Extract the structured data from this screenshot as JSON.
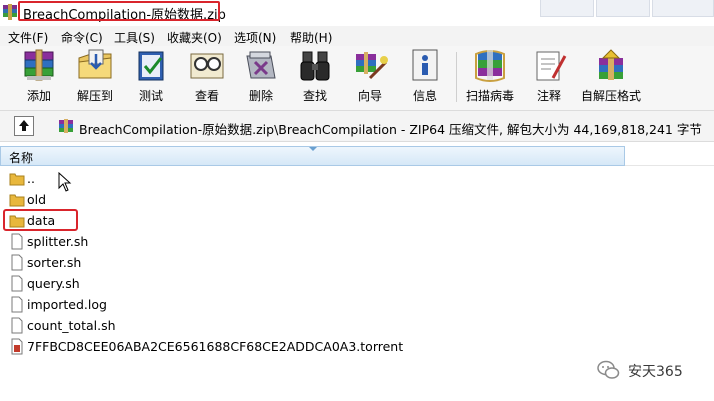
{
  "title": {
    "text": "BreachCompilation-原始数据.zip"
  },
  "menu": {
    "items": [
      {
        "label": "文件(F)"
      },
      {
        "label": "命令(C)"
      },
      {
        "label": "工具(S)"
      },
      {
        "label": "收藏夹(O)"
      },
      {
        "label": "选项(N)"
      },
      {
        "label": "帮助(H)"
      }
    ]
  },
  "toolbar": {
    "buttons": [
      {
        "label": "添加",
        "icon": "add-books-icon"
      },
      {
        "label": "解压到",
        "icon": "extract-to-icon"
      },
      {
        "label": "测试",
        "icon": "test-icon"
      },
      {
        "label": "查看",
        "icon": "view-icon"
      },
      {
        "label": "删除",
        "icon": "delete-icon"
      },
      {
        "label": "查找",
        "icon": "find-binoculars-icon"
      },
      {
        "label": "向导",
        "icon": "wizard-icon"
      },
      {
        "label": "信息",
        "icon": "info-icon"
      },
      {
        "label": "扫描病毒",
        "icon": "virus-scan-icon"
      },
      {
        "label": "注释",
        "icon": "comment-icon"
      },
      {
        "label": "自解压格式",
        "icon": "sfx-icon"
      }
    ]
  },
  "address": {
    "path": "BreachCompilation-原始数据.zip\\BreachCompilation - ZIP64 压缩文件, 解包大小为 44,169,818,241 字节"
  },
  "list": {
    "column_name": "名称",
    "rows": [
      {
        "name": "..",
        "type": "parent-folder"
      },
      {
        "name": "old",
        "type": "folder"
      },
      {
        "name": "data",
        "type": "folder"
      },
      {
        "name": "splitter.sh",
        "type": "file"
      },
      {
        "name": "sorter.sh",
        "type": "file"
      },
      {
        "name": "query.sh",
        "type": "file"
      },
      {
        "name": "imported.log",
        "type": "file"
      },
      {
        "name": "count_total.sh",
        "type": "file"
      },
      {
        "name": "7FFBCD8CEE06ABA2CE6561688CF68CE2ADDCA0A3.torrent",
        "type": "torrent"
      }
    ]
  },
  "watermark": {
    "text": "安天365"
  },
  "colors": {
    "highlight": "#d9252c",
    "header_border": "#a9c9e6",
    "folder": "#e8b73c"
  }
}
